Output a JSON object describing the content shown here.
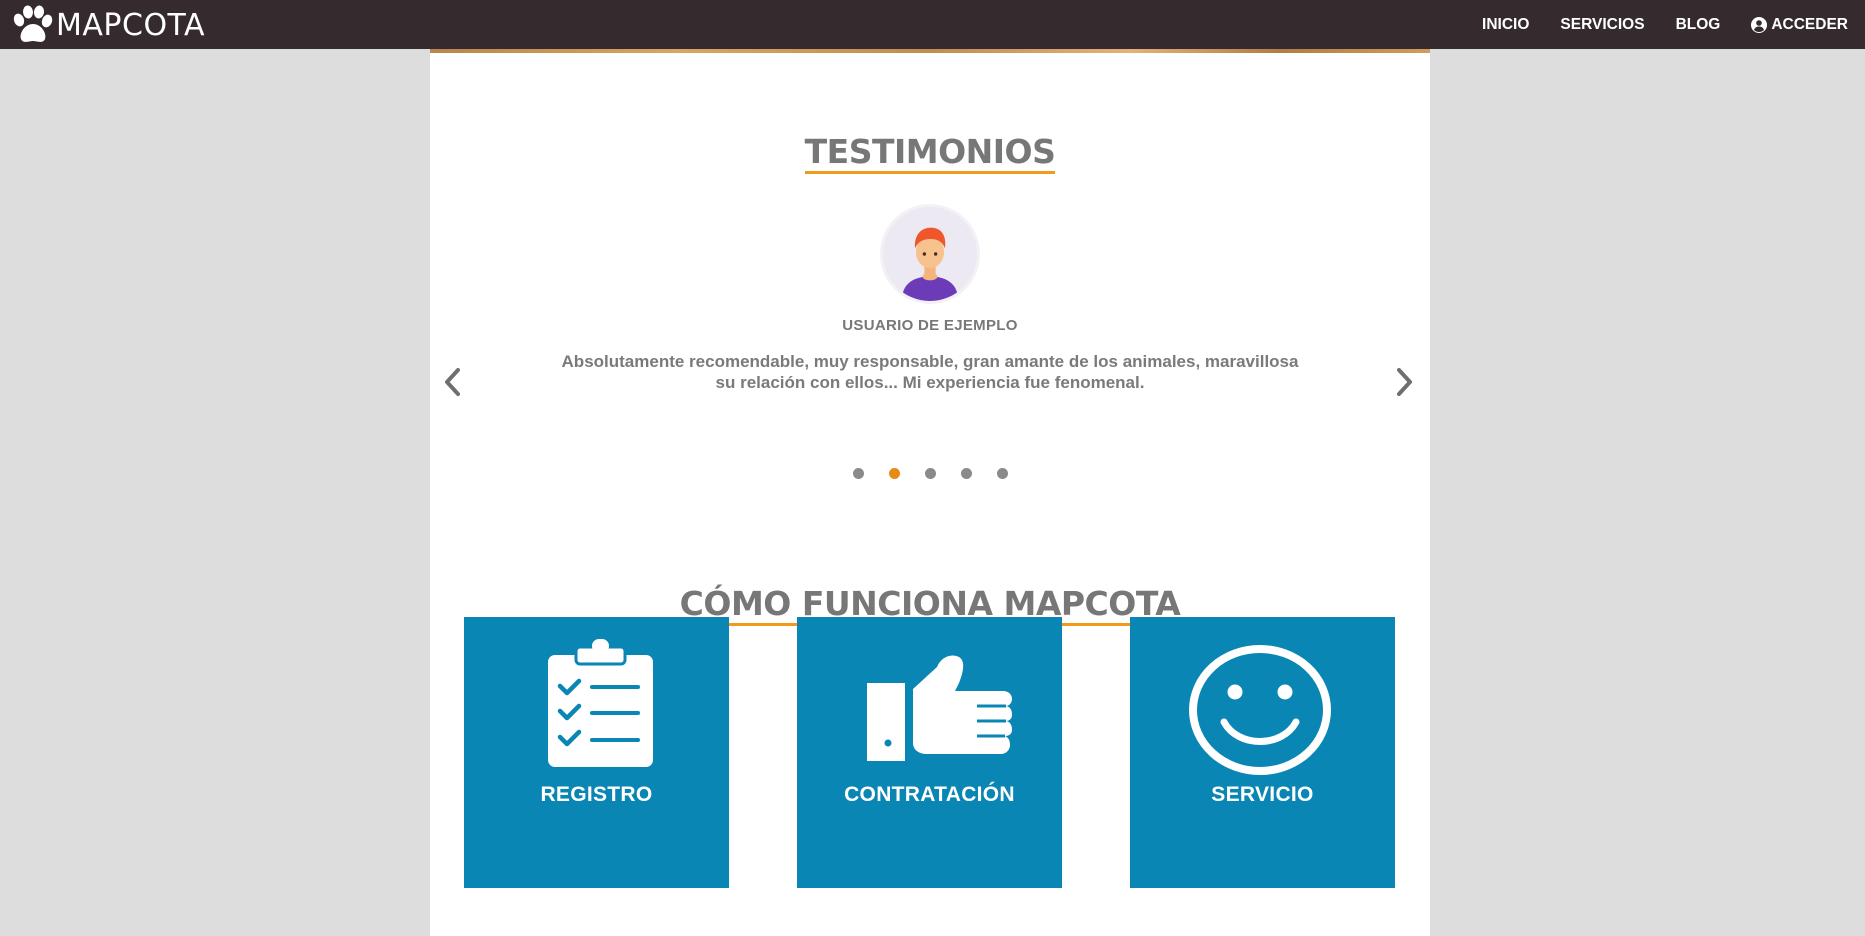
{
  "brand": {
    "name": "MAPCOTA",
    "icon": "paw-icon"
  },
  "nav": {
    "items": [
      {
        "label": "INICIO"
      },
      {
        "label": "SERVICIOS"
      },
      {
        "label": "BLOG"
      },
      {
        "label": "ACCEDER",
        "icon": "user-circle-icon"
      }
    ]
  },
  "testimonials": {
    "title": "TESTIMONIOS",
    "name": "USUARIO DE EJEMPLO",
    "text": "Absolutamente recomendable, muy responsable, gran amante de los animales, maravillosa su relación con ellos... Mi experiencia fue fenomenal.",
    "dots_count": 5,
    "active_dot": 2,
    "prev_icon": "chevron-left-icon",
    "next_icon": "chevron-right-icon"
  },
  "how_it_works": {
    "title": "CÓMO FUNCIONA MAPCOTA",
    "steps": [
      {
        "label": "REGISTRO",
        "icon": "clipboard-checklist-icon"
      },
      {
        "label": "CONTRATACIÓN",
        "icon": "thumbs-up-icon"
      },
      {
        "label": "SERVICIO",
        "icon": "smiley-face-icon"
      }
    ]
  },
  "colors": {
    "navbar": "#352b2e",
    "accent": "#f29b1b",
    "step_tile": "#0a86b4",
    "title_text": "#777777",
    "background": "#dddddd"
  }
}
